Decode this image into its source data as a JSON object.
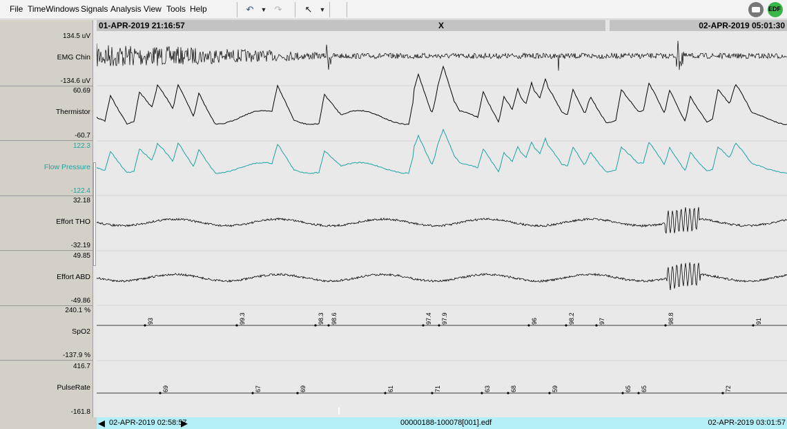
{
  "menu": {
    "items": [
      {
        "label": "File"
      },
      {
        "label": "TimeWindows"
      },
      {
        "label": "Signals"
      },
      {
        "label": "Analysis"
      },
      {
        "label": "View"
      },
      {
        "label": "Tools"
      },
      {
        "label": "Help"
      }
    ]
  },
  "toolbar": {
    "undo_icon": "undo-icon",
    "redo_icon": "redo-icon",
    "pointer_icon": "cursor-pointer-icon",
    "edf_badge": "EDF"
  },
  "timebar": {
    "start": "01-APR-2019 21:16:57",
    "close": "X",
    "end": "02-APR-2019 05:01:30"
  },
  "channels": [
    {
      "name": "EMG Chin",
      "max": "134.5 uV",
      "min": "-134.6 uV",
      "color": "#000000"
    },
    {
      "name": "Thermistor",
      "max": "60.69",
      "min": "-60.7",
      "color": "#000000"
    },
    {
      "name": "Flow Pressure",
      "max": "122.3",
      "min": "-122.4",
      "color": "#1aa3a3"
    },
    {
      "name": "Effort THO",
      "max": "32.18",
      "min": "-32.19",
      "color": "#000000"
    },
    {
      "name": "Effort ABD",
      "max": "49.85",
      "min": "-49.86",
      "color": "#000000"
    },
    {
      "name": "SpO2",
      "max": "240.1 %",
      "min": "-137.9 %",
      "color": "#000000"
    },
    {
      "name": "PulseRate",
      "max": "416.7",
      "min": "-161.8",
      "color": "#000000"
    }
  ],
  "spo2_markers": [
    "93",
    "99.3",
    "98.3",
    "98.6",
    "97.4",
    "97.9",
    "96",
    "98.2",
    "97",
    "98.8",
    "91"
  ],
  "pulse_markers": [
    "69",
    "67",
    "69",
    "61",
    "71",
    "63",
    "68",
    "59",
    "65",
    "65",
    "72"
  ],
  "bottombar": {
    "start": "02-APR-2019 02:58:57",
    "file": "00000188-100078[001].edf",
    "end": "02-APR-2019 03:01:57"
  }
}
